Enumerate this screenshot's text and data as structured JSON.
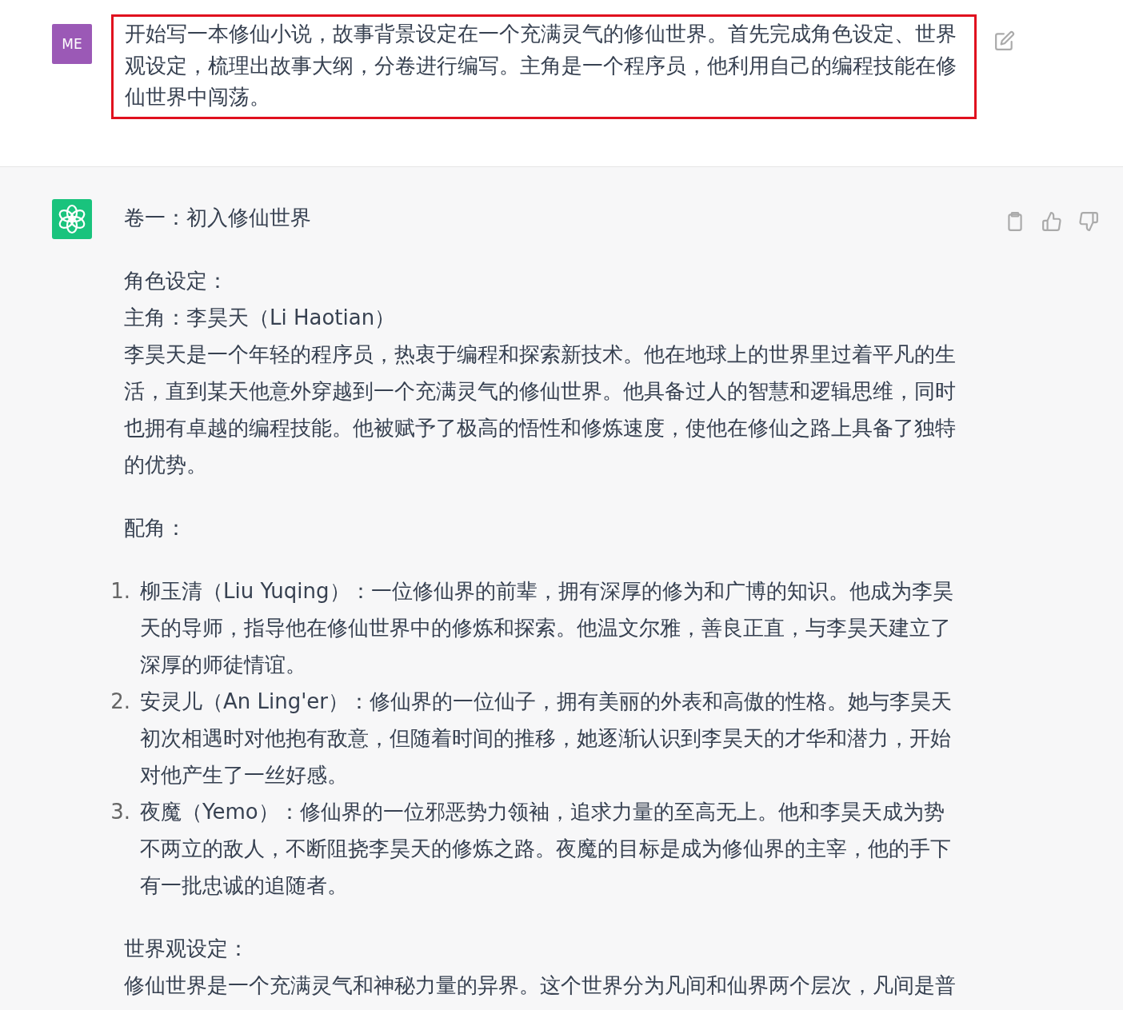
{
  "user_message": {
    "avatar": "ME",
    "text": "开始写一本修仙小说，故事背景设定在一个充满灵气的修仙世界。首先完成角色设定、世界观设定，梳理出故事大纲，分卷进行编写。主角是一个程序员，他利用自己的编程技能在修仙世界中闯荡。",
    "highlighted": true
  },
  "assistant_message": {
    "title": "卷一：初入修仙世界",
    "blocks": [
      {
        "kind": "text",
        "lines": [
          "角色设定：",
          "主角：李昊天（Li Haotian）",
          "李昊天是一个年轻的程序员，热衷于编程和探索新技术。他在地球上的世界里过着平凡的生活，直到某天他意外穿越到一个充满灵气的修仙世界。他具备过人的智慧和逻辑思维，同时也拥有卓越的编程技能。他被赋予了极高的悟性和修炼速度，使他在修仙之路上具备了独特的优势。"
        ]
      },
      {
        "kind": "text",
        "lines": [
          "配角："
        ]
      },
      {
        "kind": "list",
        "items": [
          {
            "number": "1.",
            "text": "柳玉清（Liu Yuqing）：一位修仙界的前辈，拥有深厚的修为和广博的知识。他成为李昊天的导师，指导他在修仙世界中的修炼和探索。他温文尔雅，善良正直，与李昊天建立了深厚的师徒情谊。"
          },
          {
            "number": "2.",
            "text": "安灵儿（An Ling'er）：修仙界的一位仙子，拥有美丽的外表和高傲的性格。她与李昊天初次相遇时对他抱有敌意，但随着时间的推移，她逐渐认识到李昊天的才华和潜力，开始对他产生了一丝好感。"
          },
          {
            "number": "3.",
            "text": "夜魔（Yemo）：修仙界的一位邪恶势力领袖，追求力量的至高无上。他和李昊天成为势不两立的敌人，不断阻挠李昊天的修炼之路。夜魔的目标是成为修仙界的主宰，他的手下有一批忠诚的追随者。"
          }
        ]
      },
      {
        "kind": "text",
        "lines": [
          "世界观设定：",
          "修仙世界是一个充满灵气和神秘力量的异界。这个世界分为凡间和仙界两个层次，凡间是普"
        ]
      }
    ]
  }
}
